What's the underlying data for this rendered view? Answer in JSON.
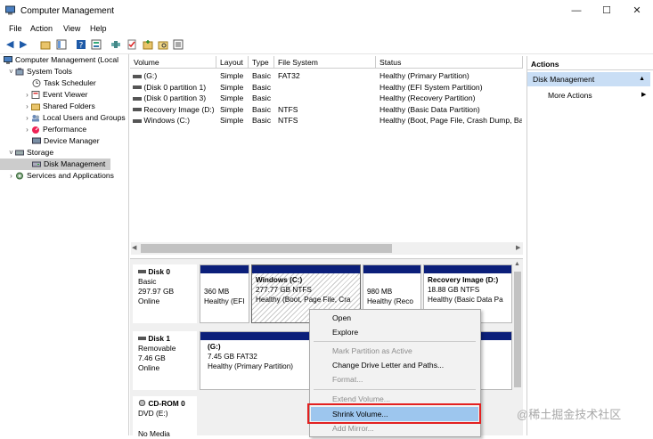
{
  "window": {
    "title": "Computer Management",
    "minimize": "—",
    "maximize": "☐",
    "close": "✕"
  },
  "menu": [
    "File",
    "Action",
    "View",
    "Help"
  ],
  "tree": {
    "root": "Computer Management (Local",
    "system_tools": "System Tools",
    "task_scheduler": "Task Scheduler",
    "event_viewer": "Event Viewer",
    "shared_folders": "Shared Folders",
    "local_users": "Local Users and Groups",
    "performance": "Performance",
    "device_manager": "Device Manager",
    "storage": "Storage",
    "disk_management": "Disk Management",
    "services": "Services and Applications"
  },
  "volume_list": {
    "columns": [
      "Volume",
      "Layout",
      "Type",
      "File System",
      "Status"
    ],
    "rows": [
      {
        "volume": "(G:)",
        "layout": "Simple",
        "type": "Basic",
        "fs": "FAT32",
        "status": "Healthy (Primary Partition)"
      },
      {
        "volume": "(Disk 0 partition 1)",
        "layout": "Simple",
        "type": "Basic",
        "fs": "",
        "status": "Healthy (EFI System Partition)"
      },
      {
        "volume": "(Disk 0 partition 3)",
        "layout": "Simple",
        "type": "Basic",
        "fs": "",
        "status": "Healthy (Recovery Partition)"
      },
      {
        "volume": "Recovery Image (D:)",
        "layout": "Simple",
        "type": "Basic",
        "fs": "NTFS",
        "status": "Healthy (Basic Data Partition)"
      },
      {
        "volume": "Windows (C:)",
        "layout": "Simple",
        "type": "Basic",
        "fs": "NTFS",
        "status": "Healthy (Boot, Page File, Crash Dump, Ba"
      }
    ]
  },
  "disks": {
    "disk0": {
      "name": "Disk 0",
      "type": "Basic",
      "size": "297.97 GB",
      "state": "Online",
      "p1_size": "360 MB",
      "p1_status": "Healthy (EFI",
      "p2_name": "Windows  (C:)",
      "p2_size": "277.77 GB NTFS",
      "p2_status": "Healthy (Boot, Page File, Cra",
      "p3_size": "980 MB",
      "p3_status": "Healthy (Reco",
      "p4_name": "Recovery Image  (D:)",
      "p4_size": "18.88 GB NTFS",
      "p4_status": "Healthy (Basic Data Pa"
    },
    "disk1": {
      "name": "Disk 1",
      "type": "Removable",
      "size": "7.46 GB",
      "state": "Online",
      "p1_name": "(G:)",
      "p1_size": "7.45 GB FAT32",
      "p1_status": "Healthy (Primary Partition)"
    },
    "cdrom": {
      "name": "CD-ROM 0",
      "type": "DVD (E:)",
      "state": "No Media"
    }
  },
  "actions": {
    "header": "Actions",
    "selected": "Disk Management",
    "more": "More Actions"
  },
  "context_menu": {
    "open": "Open",
    "explore": "Explore",
    "mark_active": "Mark Partition as Active",
    "change_letter": "Change Drive Letter and Paths...",
    "format": "Format...",
    "extend": "Extend Volume...",
    "shrink": "Shrink Volume...",
    "add_mirror": "Add Mirror..."
  },
  "watermark": "@稀土掘金技术社区",
  "colors": {
    "partition_header": "#0b1f7a",
    "highlight": "#9dc6ee",
    "callout": "#e32020"
  }
}
